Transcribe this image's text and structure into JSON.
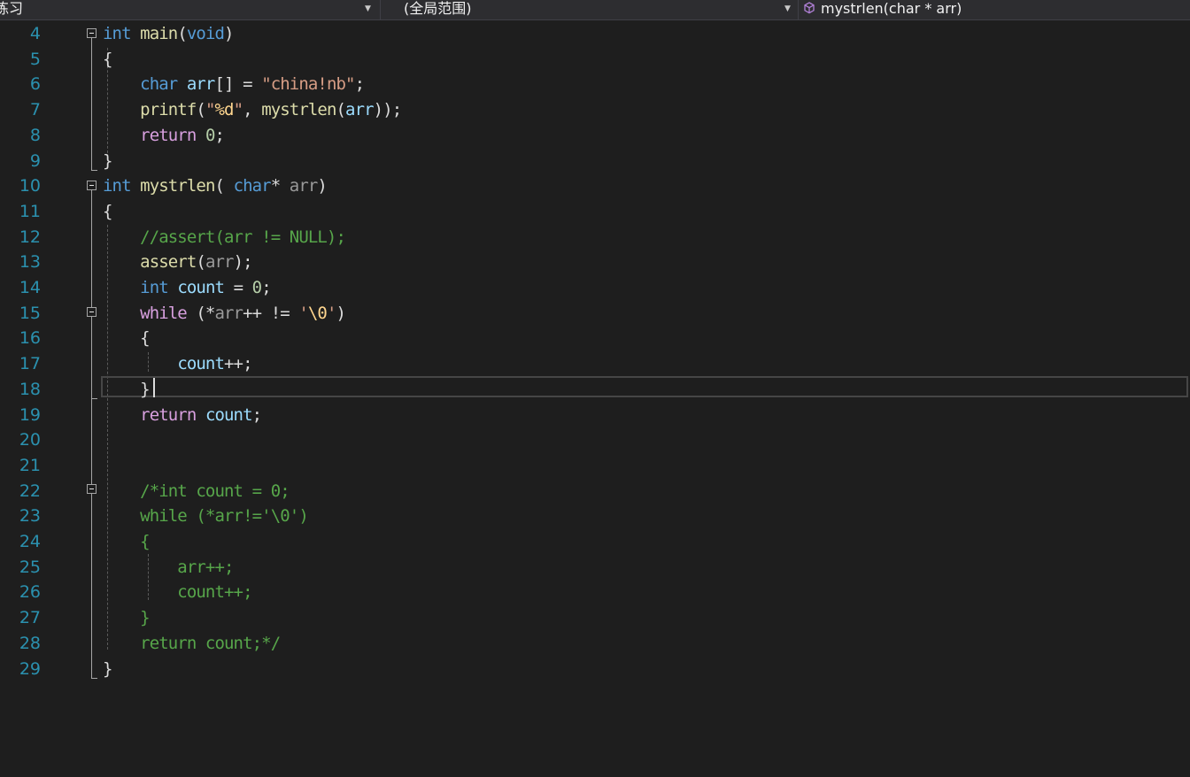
{
  "navigation_bar": {
    "project_dropdown": "练习",
    "scope_dropdown": "(全局范围)",
    "member_dropdown": "mystrlen(char * arr)",
    "member_icon": "cube-icon"
  },
  "editor": {
    "language": "c",
    "current_line": 18,
    "lines": [
      {
        "num": "4",
        "text": "int main(void)"
      },
      {
        "num": "5",
        "text": "{"
      },
      {
        "num": "6",
        "text": "    char arr[] = \"china!nb\";"
      },
      {
        "num": "7",
        "text": "    printf(\"%d\", mystrlen(arr));"
      },
      {
        "num": "8",
        "text": "    return 0;"
      },
      {
        "num": "9",
        "text": "}"
      },
      {
        "num": "10",
        "text": "int mystrlen( char* arr)"
      },
      {
        "num": "11",
        "text": "{"
      },
      {
        "num": "12",
        "text": "    //assert(arr != NULL);"
      },
      {
        "num": "13",
        "text": "    assert(arr);"
      },
      {
        "num": "14",
        "text": "    int count = 0;"
      },
      {
        "num": "15",
        "text": "    while (*arr++ != '\\0')"
      },
      {
        "num": "16",
        "text": "    {"
      },
      {
        "num": "17",
        "text": "        count++;"
      },
      {
        "num": "18",
        "text": "    }"
      },
      {
        "num": "19",
        "text": "    return count;"
      },
      {
        "num": "20",
        "text": ""
      },
      {
        "num": "21",
        "text": ""
      },
      {
        "num": "22",
        "text": "    /*int count = 0;"
      },
      {
        "num": "23",
        "text": "    while (*arr!='\\0')"
      },
      {
        "num": "24",
        "text": "    {"
      },
      {
        "num": "25",
        "text": "        arr++;"
      },
      {
        "num": "26",
        "text": "        count++;"
      },
      {
        "num": "27",
        "text": "    }"
      },
      {
        "num": "28",
        "text": "    return count;*/"
      },
      {
        "num": "29",
        "text": "}"
      }
    ]
  },
  "colors": {
    "background": "#1e1e1e",
    "line_number": "#2b91af",
    "keyword": "#569cd6",
    "control_keyword": "#d8a0df",
    "function": "#dcdcaa",
    "variable": "#9cdcfe",
    "string": "#d69d85",
    "number": "#b5cea8",
    "comment": "#57a64a"
  }
}
